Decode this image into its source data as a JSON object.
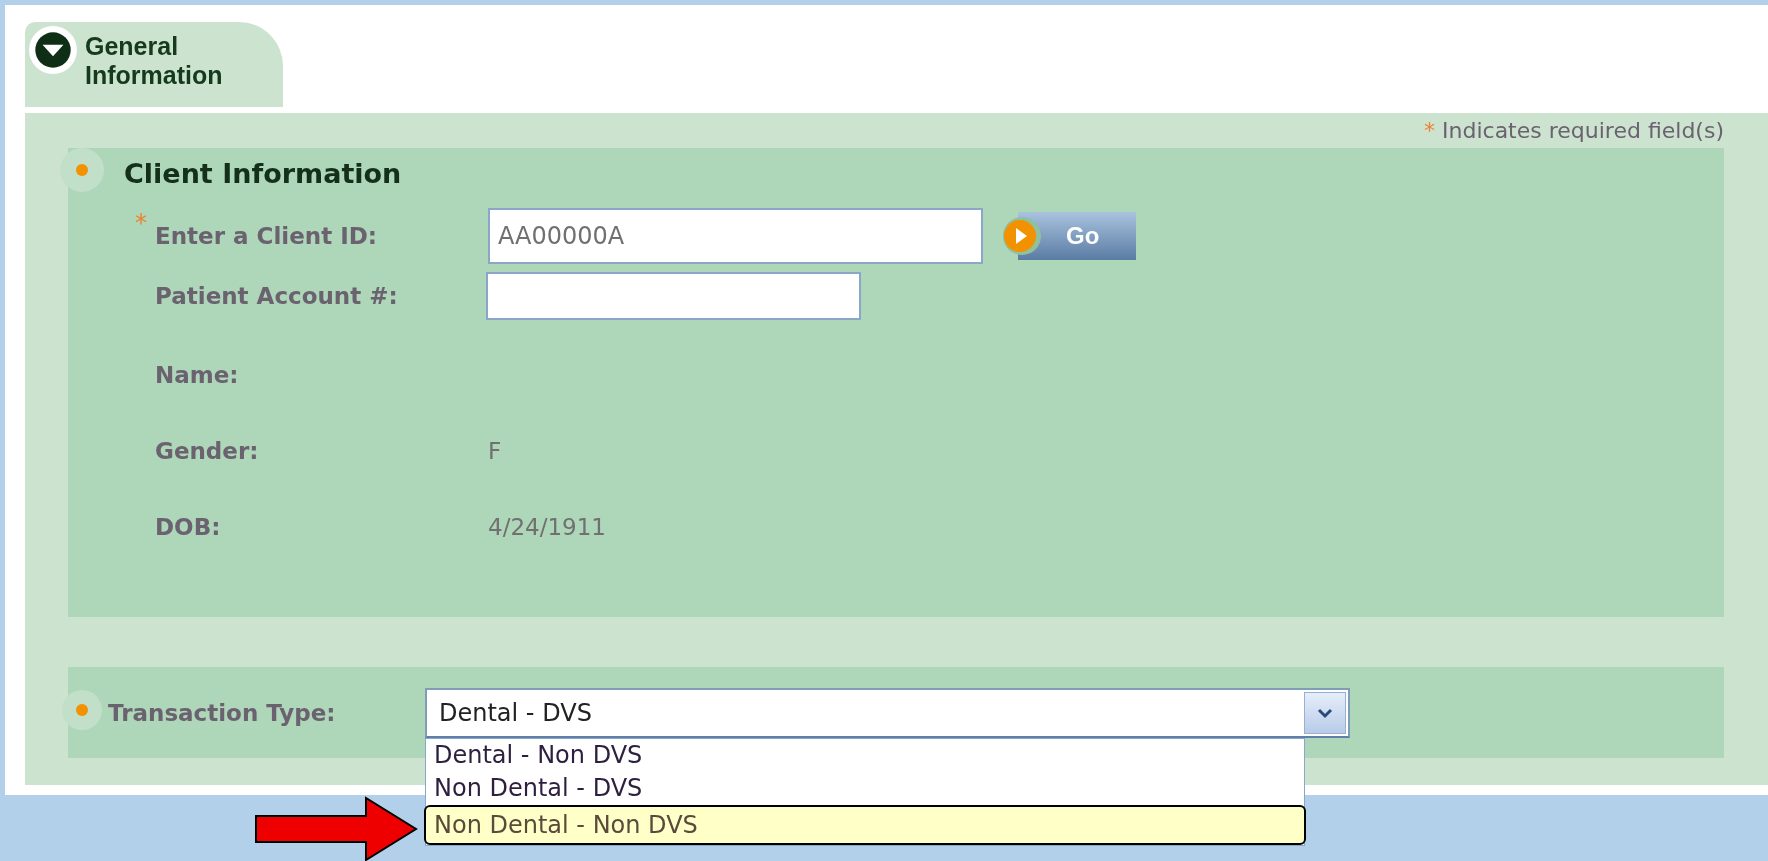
{
  "tab": {
    "label": "General Information",
    "expanded": true
  },
  "required_note": {
    "marker": "*",
    "text": "Indicates required field(s)"
  },
  "client_section": {
    "title": "Client Information",
    "go_button": "Go",
    "fields": [
      {
        "kind": "input",
        "label": "Enter a Client ID:",
        "marker": "*",
        "value": "AA00000A"
      },
      {
        "kind": "input",
        "label": "Patient Account #:"
      },
      {
        "kind": "text",
        "label": "Name:"
      },
      {
        "kind": "text",
        "label": "Gender:",
        "value": "F"
      },
      {
        "kind": "text",
        "label": "DOB:",
        "value": "4/24/1911"
      }
    ]
  },
  "transaction_type": {
    "label": "Transaction Type:",
    "value": "Dental - DVS",
    "expanded": true,
    "options": [
      {
        "label": "Dental - Non DVS",
        "selected": false
      },
      {
        "label": "Non Dental - DVS",
        "selected": false
      },
      {
        "label": "Non Dental - Non DVS",
        "selected": true
      }
    ]
  }
}
